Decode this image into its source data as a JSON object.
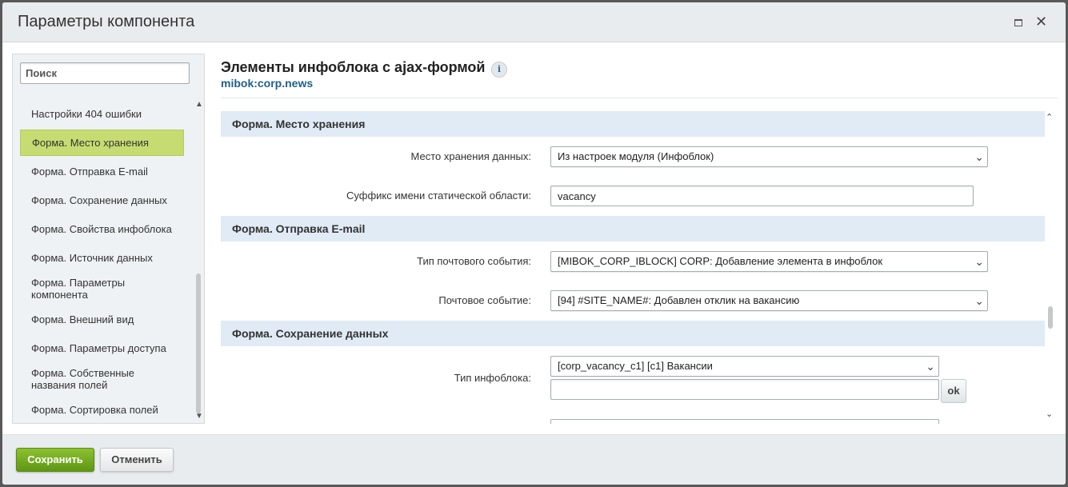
{
  "dialog": {
    "title": "Параметры компонента"
  },
  "sidebar": {
    "search_placeholder": "Поиск",
    "items": [
      {
        "label": "Настройки 404 ошибки"
      },
      {
        "label": "Форма. Место хранения",
        "active": true
      },
      {
        "label": "Форма. Отправка E-mail"
      },
      {
        "label": "Форма. Сохранение данных"
      },
      {
        "label": "Форма. Свойства инфоблока"
      },
      {
        "label": "Форма. Источник данных"
      },
      {
        "label": "Форма. Параметры компонента"
      },
      {
        "label": "Форма. Внешний вид"
      },
      {
        "label": "Форма. Параметры доступа"
      },
      {
        "label": "Форма. Собственные названия полей"
      },
      {
        "label": "Форма. Сортировка полей"
      }
    ]
  },
  "component": {
    "title": "Элементы инфоблока с ajax-формой",
    "code": "mibok:corp.news",
    "info_icon": "i"
  },
  "sections": [
    {
      "title": "Форма. Место хранения",
      "fields": [
        {
          "label": "Место хранения данных:",
          "type": "select",
          "value": "Из настроек модуля (Инфоблок)"
        },
        {
          "label": "Суффикс имени статической области:",
          "type": "text",
          "value": "vacancy"
        }
      ]
    },
    {
      "title": "Форма. Отправка E-mail",
      "fields": [
        {
          "label": "Тип почтового события:",
          "type": "select",
          "value": "[MIBOK_CORP_IBLOCK] CORP: Добавление элемента в инфоблок"
        },
        {
          "label": "Почтовое событие:",
          "type": "select",
          "value": "[94] #SITE_NAME#: Добавлен отклик на вакансию"
        }
      ]
    },
    {
      "title": "Форма. Сохранение данных",
      "fields": [
        {
          "label": "Тип инфоблока:",
          "type": "select",
          "value": "[corp_vacancy_c1] [c1] Вакансии",
          "extra_input_value": "",
          "ok_label": "ok"
        }
      ]
    }
  ],
  "footer": {
    "save_label": "Сохранить",
    "cancel_label": "Отменить"
  },
  "colors": {
    "save_button": "#6ea51c",
    "active_nav": "#c6dc72",
    "section_header": "#e1ebf5",
    "component_code": "#1f5f8b"
  }
}
